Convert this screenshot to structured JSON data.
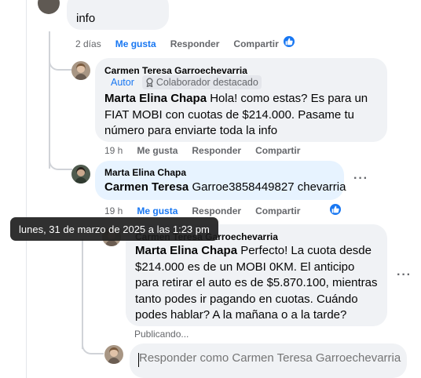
{
  "top_comment": {
    "text_tail": "info",
    "time": "2 días",
    "like": "Me gusta",
    "reply": "Responder",
    "share": "Compartir"
  },
  "reply1": {
    "author": "Carmen Teresa Garroechevarria",
    "badge_author": "Autor",
    "badge_contributor": "Colaborador destacado",
    "mention": "Marta Elina Chapa",
    "text": " Hola! como estas? Es para un FIAT MOBI con cuotas de $214.000. Pasame tu número para enviarte toda la info",
    "time": "19 h",
    "like": "Me gusta",
    "reply": "Responder",
    "share": "Compartir"
  },
  "reply2": {
    "author": "Marta Elina Chapa",
    "mention": "Carmen Teresa",
    "text": " Garroe3858449827 chevarria",
    "time": "19 h",
    "like": "Me gusta",
    "reply": "Responder",
    "share": "Compartir"
  },
  "reply3": {
    "author": "Carmen Teresa Garroechevarria",
    "mention": "Marta Elina Chapa",
    "text": " Perfecto! La cuota desde $214.000 es de un MOBI 0KM. El anticipo para retirar el auto es de $5.870.100, mientras tanto podes ir pagando en cuotas. Cuándo podes hablar? A la mañana o a la tarde?",
    "status": "Publicando..."
  },
  "tooltip": "lunes, 31 de marzo de 2025 a las 1:23 pm",
  "reply_box": {
    "placeholder": "Responder como Carmen Teresa Garroechevarria"
  },
  "colors": {
    "accent": "#1877f2",
    "bubble": "#f0f2f5",
    "highlight_bubble": "#e7f3ff",
    "muted": "#65676b"
  }
}
